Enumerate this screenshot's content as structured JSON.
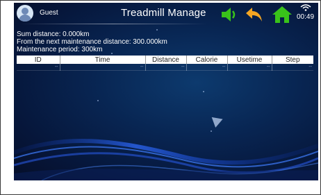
{
  "header": {
    "user": "Guest",
    "title": "Treadmill Manage",
    "time": "00:49",
    "icons": {
      "speaker": "speaker-icon",
      "back": "back-arrow-icon",
      "home": "home-icon",
      "wifi": "wifi-icon"
    }
  },
  "info": {
    "sum_distance": "Sum distance: 0.000km",
    "next_maintenance": "From the next maintenance distance: 300.000km",
    "period": "Maintenance period: 300km"
  },
  "table": {
    "columns": [
      "ID",
      "Time",
      "Distance",
      "Calorie",
      "Usetime",
      "Step"
    ],
    "rows": [
      [
        "--",
        "--",
        "--",
        "--",
        "--",
        "--"
      ]
    ]
  },
  "colors": {
    "accent_green": "#39c21a",
    "icon_orange": "#f5a623",
    "background": "#082552"
  }
}
